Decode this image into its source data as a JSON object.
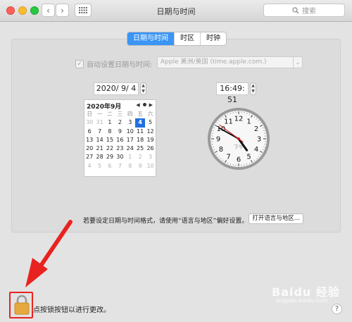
{
  "window": {
    "title": "日期与时间"
  },
  "search": {
    "placeholder": "搜索"
  },
  "tabs": [
    {
      "label": "日期与时间",
      "active": true
    },
    {
      "label": "时区",
      "active": false
    },
    {
      "label": "时钟",
      "active": false
    }
  ],
  "autoset": {
    "label": "自动设置日期与时间:",
    "checked": true,
    "server": "Apple 美洲/美国 (time.apple.com.)"
  },
  "date_value": "2020/ 9/ 4",
  "time_value": "16:49: 51",
  "calendar": {
    "month_title": "2020年9月",
    "weekdays": [
      "日",
      "一",
      "二",
      "三",
      "四",
      "五",
      "六"
    ],
    "weeks": [
      [
        "30",
        "31",
        "1",
        "2",
        "3",
        "4",
        "5"
      ],
      [
        "6",
        "7",
        "8",
        "9",
        "10",
        "11",
        "12"
      ],
      [
        "13",
        "14",
        "15",
        "16",
        "17",
        "18",
        "19"
      ],
      [
        "20",
        "21",
        "22",
        "23",
        "24",
        "25",
        "26"
      ],
      [
        "27",
        "28",
        "29",
        "30",
        "1",
        "2",
        "3"
      ],
      [
        "4",
        "5",
        "6",
        "7",
        "8",
        "9",
        "10"
      ]
    ],
    "selected": "4"
  },
  "clock": {
    "hour": 16,
    "minute": 49,
    "second": 51,
    "ampm_label": "下午",
    "numbers": [
      "12",
      "1",
      "2",
      "3",
      "4",
      "5",
      "6",
      "7",
      "8",
      "9",
      "10",
      "11"
    ]
  },
  "hint_text": "若要设定日期与时间格式，请使用“语言与地区”偏好设置。",
  "open_language_button": "打开语言与地区...",
  "lock_text": "点按锁按钮以进行更改。",
  "help_label": "?",
  "watermark": {
    "text": "Baidu 经验",
    "sub": "jingyan.baidu.com"
  },
  "colors": {
    "accent": "#3b95f5",
    "selected_day": "#1f6fe0",
    "annotation": "#e8231f",
    "second_hand": "#d31a1a"
  }
}
